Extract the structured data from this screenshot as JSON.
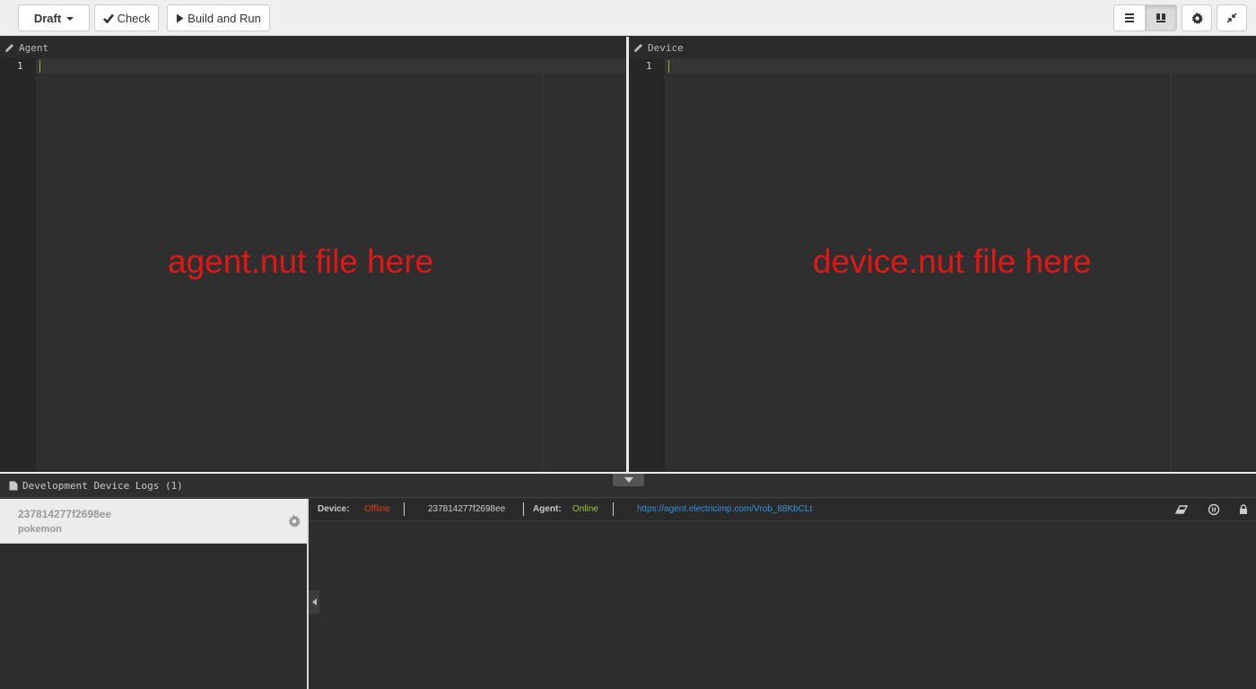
{
  "toolbar": {
    "draft_label": "Draft",
    "check_label": "Check",
    "build_label": "Build and Run"
  },
  "editors": {
    "agent": {
      "title": "Agent",
      "line_number": "1",
      "placeholder": "agent.nut file here"
    },
    "device": {
      "title": "Device",
      "line_number": "1",
      "placeholder": "device.nut file here"
    }
  },
  "logs": {
    "header": "Development Device Logs (1)"
  },
  "device_list": {
    "items": [
      {
        "id": "237814277f2698ee",
        "name": "pokemon"
      }
    ]
  },
  "status": {
    "device_label": "Device:",
    "device_status": "Offline",
    "device_id": "237814277f2698ee",
    "agent_label": "Agent:",
    "agent_status": "Online",
    "agent_url": "https://agent.electricimp.com/Vrob_88KbCLt"
  },
  "colors": {
    "placeholder_text": "#e31616",
    "offline": "#d9431b",
    "online": "#9bc53d",
    "link": "#3a8fd9"
  },
  "icons": [
    "checkmark-icon",
    "play-icon",
    "list-view-icon",
    "split-view-icon",
    "gear-icon",
    "collapse-icon",
    "pencil-icon",
    "file-icon",
    "eraser-icon",
    "pause-icon",
    "lock-icon"
  ]
}
